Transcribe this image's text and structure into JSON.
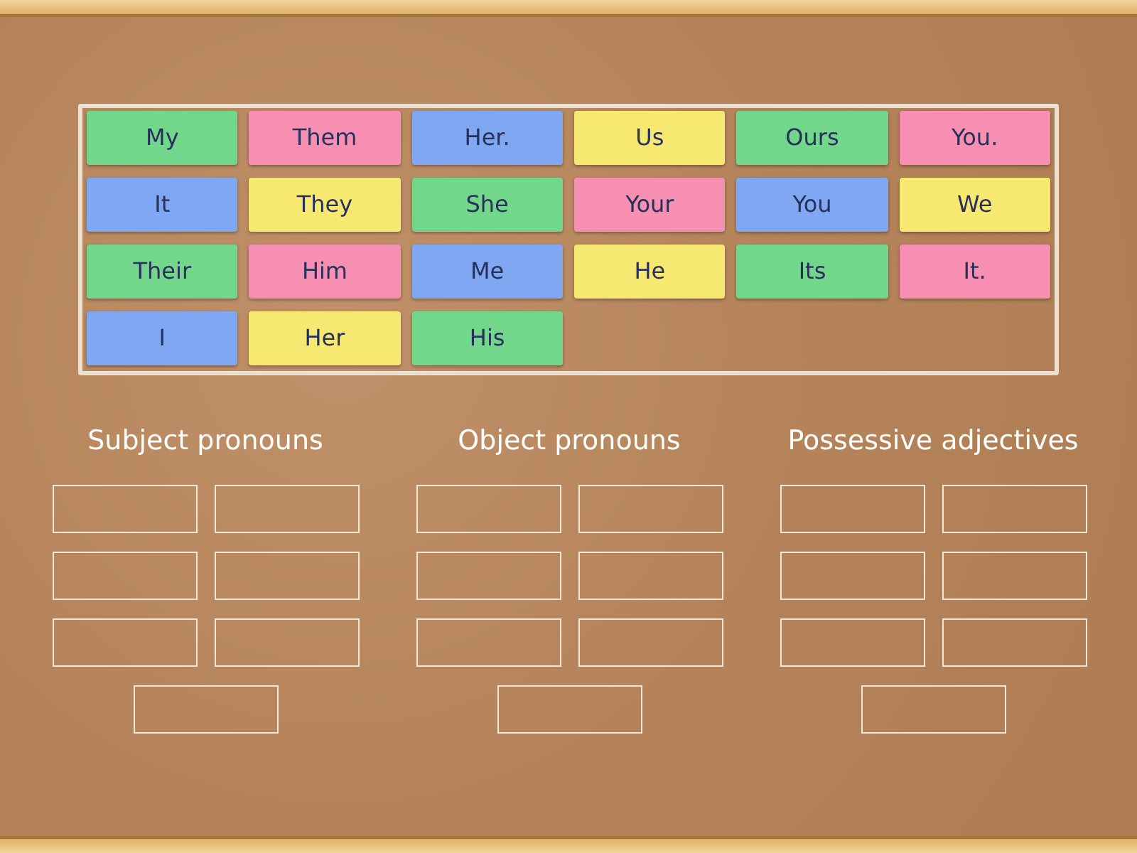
{
  "cards": [
    {
      "label": "My",
      "color": "#72d68b"
    },
    {
      "label": "Them",
      "color": "#f78fb3"
    },
    {
      "label": "Her.",
      "color": "#7fa7f2"
    },
    {
      "label": "Us",
      "color": "#f6e870"
    },
    {
      "label": "Ours",
      "color": "#72d68b"
    },
    {
      "label": "You.",
      "color": "#f78fb3"
    },
    {
      "label": "It",
      "color": "#7fa7f2"
    },
    {
      "label": "They",
      "color": "#f6e870"
    },
    {
      "label": "She",
      "color": "#72d68b"
    },
    {
      "label": "Your",
      "color": "#f78fb3"
    },
    {
      "label": "You",
      "color": "#7fa7f2"
    },
    {
      "label": "We",
      "color": "#f6e870"
    },
    {
      "label": "Their",
      "color": "#72d68b"
    },
    {
      "label": "Him",
      "color": "#f78fb3"
    },
    {
      "label": "Me",
      "color": "#7fa7f2"
    },
    {
      "label": "He",
      "color": "#f6e870"
    },
    {
      "label": "Its",
      "color": "#72d68b"
    },
    {
      "label": "It.",
      "color": "#f78fb3"
    },
    {
      "label": "I",
      "color": "#7fa7f2"
    },
    {
      "label": "Her",
      "color": "#f6e870"
    },
    {
      "label": "His",
      "color": "#72d68b"
    }
  ],
  "groups": [
    {
      "title": "Subject pronouns",
      "slots": [
        {
          "filled": false
        },
        {
          "filled": false
        },
        {
          "filled": false
        },
        {
          "filled": false
        },
        {
          "filled": false
        },
        {
          "filled": false
        },
        {
          "filled": false
        }
      ]
    },
    {
      "title": "Object pronouns",
      "slots": [
        {
          "filled": false
        },
        {
          "filled": false
        },
        {
          "filled": false
        },
        {
          "filled": false
        },
        {
          "filled": false
        },
        {
          "filled": false
        },
        {
          "filled": false
        }
      ]
    },
    {
      "title": "Possessive adjectives",
      "slots": [
        {
          "filled": false
        },
        {
          "filled": false
        },
        {
          "filled": false
        },
        {
          "filled": false
        },
        {
          "filled": false
        },
        {
          "filled": false
        },
        {
          "filled": false
        }
      ]
    }
  ]
}
